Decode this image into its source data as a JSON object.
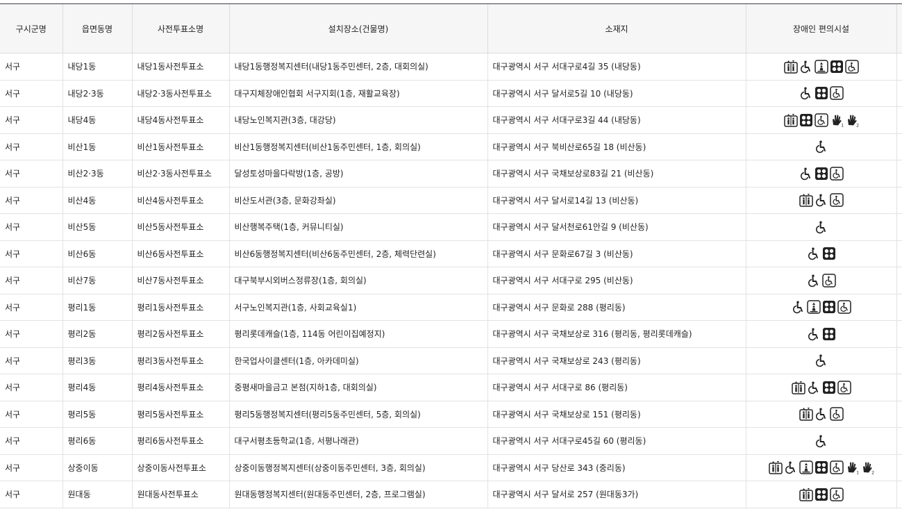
{
  "headers": [
    "구시군명",
    "읍면동명",
    "사전투표소명",
    "설치장소(건물명)",
    "소재지",
    "장애인 편의시설"
  ],
  "rows": [
    {
      "gu": "서구",
      "dong": "내당1동",
      "station": "내당1동사전투표소",
      "place": "내당1동행정복지센터(내당1동주민센터, 2층, 대회의실)",
      "addr": "대구광역시 서구 서대구로4길 35 (내당동)",
      "icons": [
        "elevator-icon",
        "wheelchair-icon",
        "lift-icon",
        "braille-icon",
        "accessible-ramp-icon"
      ]
    },
    {
      "gu": "서구",
      "dong": "내당2·3동",
      "station": "내당2·3동사전투표소",
      "place": "대구지체장애인협회 서구지회(1층, 재활교육장)",
      "addr": "대구광역시 서구 달서로5길 10 (내당동)",
      "icons": [
        "wheelchair-icon",
        "braille-icon",
        "accessible-ramp-icon"
      ]
    },
    {
      "gu": "서구",
      "dong": "내당4동",
      "station": "내당4동사전투표소",
      "place": "내당노인복지관(3층, 대강당)",
      "addr": "대구광역시 서구 서대구로3길 44 (내당동)",
      "icons": [
        "elevator-icon",
        "braille-icon",
        "accessible-ramp-icon",
        "sign-language-1-icon",
        "sign-language-2-icon"
      ]
    },
    {
      "gu": "서구",
      "dong": "비산1동",
      "station": "비산1동사전투표소",
      "place": "비산1동행정복지센터(비산1동주민센터, 1층, 회의실)",
      "addr": "대구광역시 서구 북비산로65길 18 (비산동)",
      "icons": [
        "wheelchair-icon"
      ]
    },
    {
      "gu": "서구",
      "dong": "비산2·3동",
      "station": "비산2·3동사전투표소",
      "place": "달성토성마을다락방(1층, 공방)",
      "addr": "대구광역시 서구 국채보상로83길 21 (비산동)",
      "icons": [
        "wheelchair-icon",
        "braille-icon",
        "accessible-ramp-icon"
      ]
    },
    {
      "gu": "서구",
      "dong": "비산4동",
      "station": "비산4동사전투표소",
      "place": "비산도서관(3층, 문화강좌실)",
      "addr": "대구광역시 서구 달서로14길 13 (비산동)",
      "icons": [
        "elevator-icon",
        "wheelchair-icon",
        "accessible-ramp-icon"
      ]
    },
    {
      "gu": "서구",
      "dong": "비산5동",
      "station": "비산5동사전투표소",
      "place": "비산행복주택(1층, 커뮤니티실)",
      "addr": "대구광역시 서구 달서천로61안길 9 (비산동)",
      "icons": [
        "wheelchair-icon"
      ]
    },
    {
      "gu": "서구",
      "dong": "비산6동",
      "station": "비산6동사전투표소",
      "place": "비산6동행정복지센터(비산6동주민센터, 2층, 체력단련실)",
      "addr": "대구광역시 서구 문화로67길 3 (비산동)",
      "icons": [
        "wheelchair-icon",
        "braille-icon"
      ]
    },
    {
      "gu": "서구",
      "dong": "비산7동",
      "station": "비산7동사전투표소",
      "place": "대구북부시외버스정류장(1층, 회의실)",
      "addr": "대구광역시 서구 서대구로 295 (비산동)",
      "icons": [
        "wheelchair-icon",
        "accessible-ramp-icon"
      ]
    },
    {
      "gu": "서구",
      "dong": "평리1동",
      "station": "평리1동사전투표소",
      "place": "서구노인복지관(1층, 사회교육실1)",
      "addr": "대구광역시 서구 문화로 288 (평리동)",
      "icons": [
        "wheelchair-icon",
        "lift-icon",
        "braille-icon",
        "accessible-ramp-icon"
      ]
    },
    {
      "gu": "서구",
      "dong": "평리2동",
      "station": "평리2동사전투표소",
      "place": "평리롯데캐슬(1층, 114동 어린이집예정지)",
      "addr": "대구광역시 서구 국채보상로 316 (평리동, 평리롯데캐슬)",
      "icons": [
        "wheelchair-icon",
        "braille-icon"
      ]
    },
    {
      "gu": "서구",
      "dong": "평리3동",
      "station": "평리3동사전투표소",
      "place": "한국업사이클센터(1층, 아카데미실)",
      "addr": "대구광역시 서구 국채보상로 243 (평리동)",
      "icons": [
        "wheelchair-icon"
      ]
    },
    {
      "gu": "서구",
      "dong": "평리4동",
      "station": "평리4동사전투표소",
      "place": "중평새마을금고 본점(지하1층, 대회의실)",
      "addr": "대구광역시 서구 서대구로 86 (평리동)",
      "icons": [
        "elevator-icon",
        "wheelchair-icon",
        "braille-icon",
        "accessible-ramp-icon"
      ]
    },
    {
      "gu": "서구",
      "dong": "평리5동",
      "station": "평리5동사전투표소",
      "place": "평리5동행정복지센터(평리5동주민센터, 5층, 회의실)",
      "addr": "대구광역시 서구 국채보상로 151 (평리동)",
      "icons": [
        "elevator-icon",
        "wheelchair-icon",
        "accessible-ramp-icon"
      ]
    },
    {
      "gu": "서구",
      "dong": "평리6동",
      "station": "평리6동사전투표소",
      "place": "대구서평초등학교(1층, 서평나래관)",
      "addr": "대구광역시 서구 서대구로45길 60 (평리동)",
      "icons": [
        "wheelchair-icon"
      ]
    },
    {
      "gu": "서구",
      "dong": "상중이동",
      "station": "상중이동사전투표소",
      "place": "상중이동행정복지센터(상중이동주민센터, 3층, 회의실)",
      "addr": "대구광역시 서구 당산로 343 (중리동)",
      "icons": [
        "elevator-icon",
        "wheelchair-icon",
        "lift-icon",
        "braille-icon",
        "accessible-ramp-icon",
        "sign-language-1-icon",
        "sign-language-2-icon"
      ]
    },
    {
      "gu": "서구",
      "dong": "원대동",
      "station": "원대동사전투표소",
      "place": "원대동행정복지센터(원대동주민센터, 2층, 프로그램실)",
      "addr": "대구광역시 서구 달서로 257 (원대동3가)",
      "icons": [
        "elevator-icon",
        "braille-icon",
        "accessible-ramp-icon"
      ]
    }
  ]
}
